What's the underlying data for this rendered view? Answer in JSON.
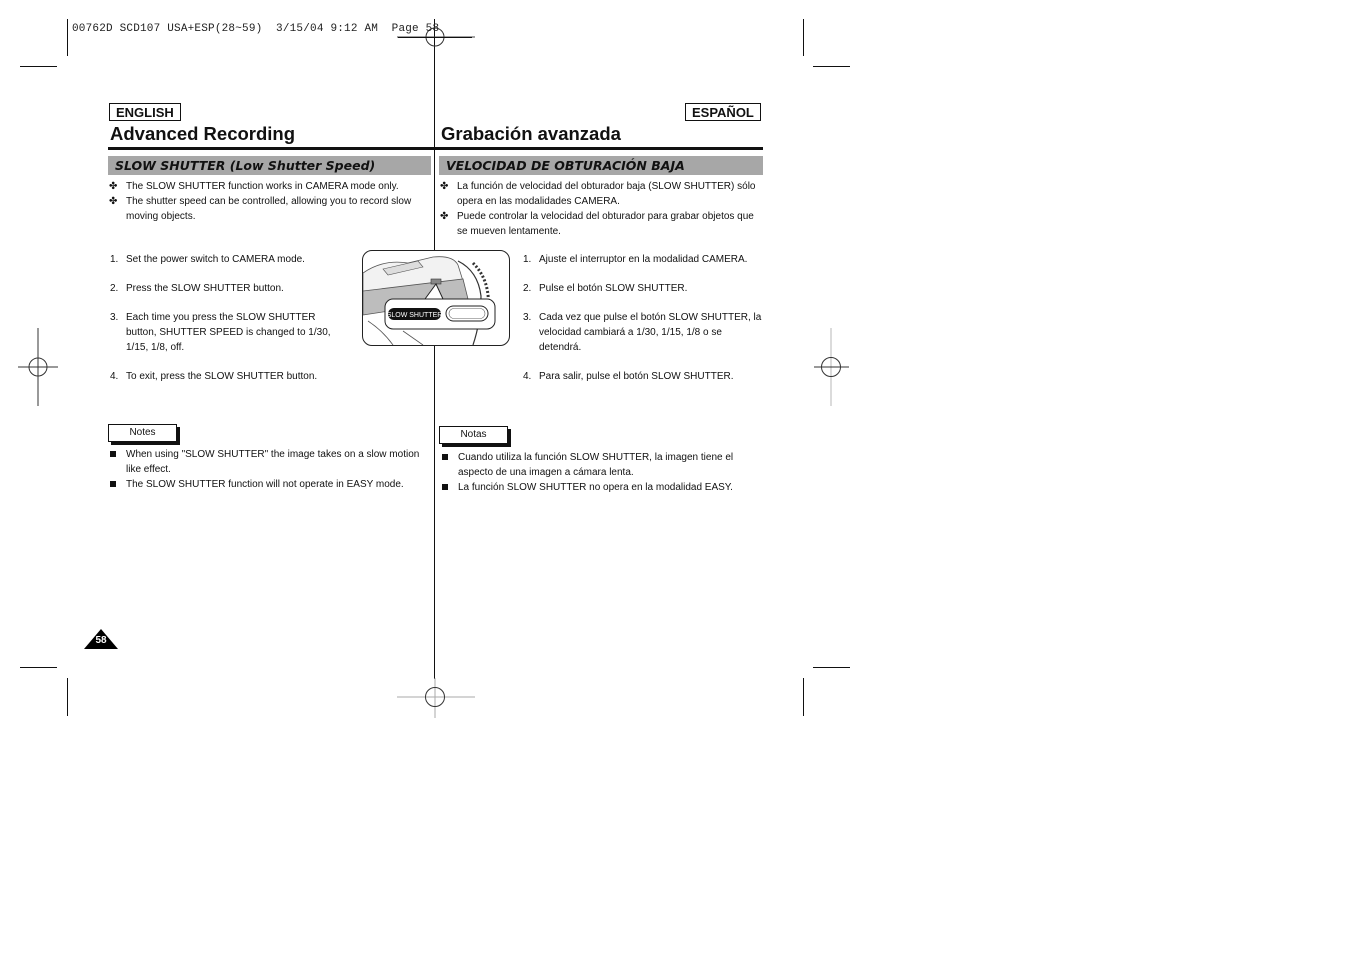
{
  "slug": {
    "text": "00762D SCD107 USA+ESP(28~59)  3/15/04 9:12 AM  Page 58"
  },
  "english": {
    "lang_tag": "ENGLISH",
    "title": "Advanced Recording",
    "section": "SLOW SHUTTER (Low Shutter Speed)",
    "intro_bullets": [
      "The SLOW SHUTTER function works in CAMERA mode only.",
      "The shutter speed can be controlled, allowing you to record slow moving objects."
    ],
    "steps": [
      {
        "num": "1.",
        "text": "Set the power switch to CAMERA mode."
      },
      {
        "num": "2.",
        "text": "Press the SLOW SHUTTER button."
      },
      {
        "num": "3.",
        "text": "Each time you press the SLOW SHUTTER button, SHUTTER SPEED is changed to 1/30, 1/15, 1/8, off."
      },
      {
        "num": "4.",
        "text": "To exit, press the SLOW SHUTTER button."
      }
    ],
    "notes_label": "Notes",
    "notes": [
      "When using \"SLOW SHUTTER\" the image takes on a slow motion like effect.",
      "The SLOW SHUTTER function will not operate in EASY mode."
    ]
  },
  "spanish": {
    "lang_tag": "ESPAÑOL",
    "title": "Grabación avanzada",
    "section": "VELOCIDAD DE OBTURACIÓN BAJA",
    "intro_bullets": [
      "La función de velocidad del obturador baja (SLOW SHUTTER) sólo opera en las modalidades CAMERA.",
      "Puede controlar la velocidad del obturador para grabar objetos que se mueven lentamente."
    ],
    "steps": [
      {
        "num": "1.",
        "text": "Ajuste el interruptor en la modalidad CAMERA."
      },
      {
        "num": "2.",
        "text": "Pulse el botón SLOW SHUTTER."
      },
      {
        "num": "3.",
        "text": "Cada vez que pulse el botón SLOW SHUTTER, la velocidad cambiará a 1/30, 1/15, 1/8 o se detendrá."
      },
      {
        "num": "4.",
        "text": "Para salir, pulse el botón SLOW SHUTTER."
      }
    ],
    "notes_label": "Notas",
    "notes": [
      "Cuando utiliza la función SLOW SHUTTER, la imagen tiene el aspecto de una imagen a cámara lenta.",
      "La función SLOW SHUTTER no opera en la modalidad EASY."
    ]
  },
  "illustration": {
    "button_label": "SLOW SHUTTER"
  },
  "bullet_glyphs": {
    "intro": "✤"
  },
  "page_number": "58",
  "colors": {
    "section_bar": "#a7a7a7",
    "ink": "#111111"
  }
}
